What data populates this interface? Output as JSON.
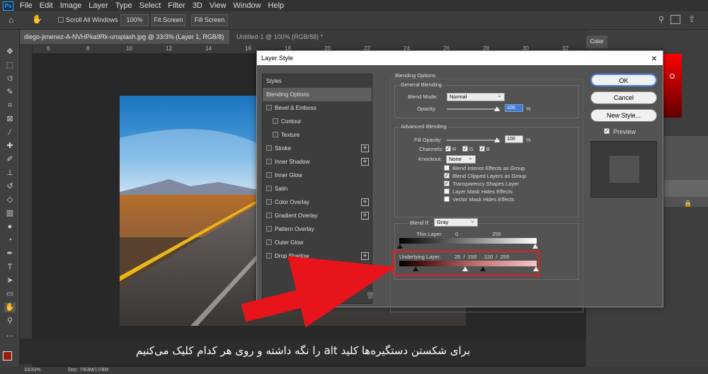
{
  "menubar": {
    "app_icon": "Ps",
    "items": [
      "File",
      "Edit",
      "Image",
      "Layer",
      "Type",
      "Select",
      "Filter",
      "3D",
      "View",
      "Window",
      "Help"
    ]
  },
  "options": {
    "scroll_all_windows": "Scroll All Windows",
    "zoom": "100%",
    "fit_screen": "Fit Screen",
    "fill_screen": "Fill Screen"
  },
  "tabs": [
    {
      "label": "diego-jimenez-A-NVHPka9Rk-unsplash.jpg @ 33/3% (Layer 1, RGB/8) *"
    },
    {
      "label": "Untitled-1 @ 100% (RGB/88) *"
    }
  ],
  "ruler_marks": [
    "6",
    "8",
    "10",
    "12",
    "14",
    "16",
    "18",
    "20",
    "22",
    "24",
    "26",
    "28",
    "30",
    "32"
  ],
  "statusbar": {
    "zoom": "33/33%",
    "doc": "Doc: 7/63M/17/8M"
  },
  "right_panel": {
    "color_tab": "Color"
  },
  "caption": "برای شکستن دستگیره‌ها کلید alt را نگه داشته و روی هر کدام کلیک می‌کنیم",
  "dialog": {
    "title": "Layer Style",
    "buttons": {
      "ok": "OK",
      "cancel": "Cancel",
      "new_style": "New Style...",
      "preview": "Preview"
    },
    "styles_header": "Styles",
    "style_items": [
      {
        "label": "Blending Options",
        "checkbox": false,
        "plus": false,
        "active": true,
        "indent": 0
      },
      {
        "label": "Bevel & Emboss",
        "checkbox": true,
        "plus": false,
        "active": false,
        "indent": 0
      },
      {
        "label": "Contour",
        "checkbox": true,
        "plus": false,
        "active": false,
        "indent": 1
      },
      {
        "label": "Texture",
        "checkbox": true,
        "plus": false,
        "active": false,
        "indent": 1
      },
      {
        "label": "Stroke",
        "checkbox": true,
        "plus": true,
        "active": false,
        "indent": 0
      },
      {
        "label": "Inner Shadow",
        "checkbox": true,
        "plus": true,
        "active": false,
        "indent": 0
      },
      {
        "label": "Inner Glow",
        "checkbox": true,
        "plus": false,
        "active": false,
        "indent": 0
      },
      {
        "label": "Satin",
        "checkbox": true,
        "plus": false,
        "active": false,
        "indent": 0
      },
      {
        "label": "Color Overlay",
        "checkbox": true,
        "plus": true,
        "active": false,
        "indent": 0
      },
      {
        "label": "Gradient Overlay",
        "checkbox": true,
        "plus": true,
        "active": false,
        "indent": 0
      },
      {
        "label": "Pattern Overlay",
        "checkbox": true,
        "plus": false,
        "active": false,
        "indent": 0
      },
      {
        "label": "Outer Glow",
        "checkbox": true,
        "plus": false,
        "active": false,
        "indent": 0
      },
      {
        "label": "Drop Shadow",
        "checkbox": true,
        "plus": true,
        "active": false,
        "indent": 0
      }
    ],
    "blending": {
      "section_title": "Blending Options",
      "general_title": "General Blending",
      "blend_mode_label": "Blend Mode:",
      "blend_mode_value": "Normal",
      "opacity_label": "Opacity:",
      "opacity_value": "100",
      "pct": "%",
      "advanced_title": "Advanced Blending",
      "fill_opacity_label": "Fill Opacity:",
      "fill_opacity_value": "100",
      "channels_label": "Channels:",
      "channel_r": "R",
      "channel_g": "G",
      "channel_b": "B",
      "knockout_label": "Knockout:",
      "knockout_value": "None",
      "opt1": "Blend Interior Effects as Group",
      "opt2": "Blend Clipped Layers as Group",
      "opt3": "Transparency Shapes Layer",
      "opt4": "Layer Mask Hides Effects",
      "opt5": "Vector Mask Hides Effects",
      "opt_checked": [
        false,
        true,
        true,
        false,
        false
      ],
      "blend_if_label": "Blend If:",
      "blend_if_value": "Gray",
      "this_layer_label": "This Layer:",
      "this_layer_min": "0",
      "this_layer_max": "255",
      "underlying_label": "Underlying Layer:",
      "underlying_values": "25  /  150     120  /  255"
    }
  },
  "colors": {
    "highlight": "#e02020",
    "arrow": "#e8141b"
  }
}
